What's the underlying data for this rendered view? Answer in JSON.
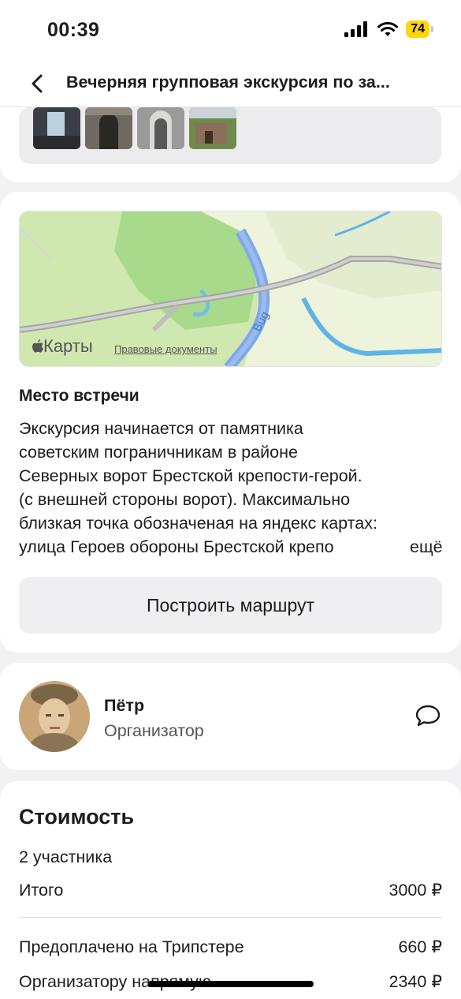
{
  "status": {
    "time": "00:39",
    "battery": "74"
  },
  "nav": {
    "title": "Вечерняя групповая экскурсия по за..."
  },
  "map": {
    "brand": "Карты",
    "legal": "Правовые документы",
    "river_label": "Bug"
  },
  "meeting": {
    "title": "Место встречи",
    "lines": [
      "Экскурсия начинается от памятника",
      "советским пограничникам в районе",
      "Северных ворот Брестской крепости-герой.",
      "(с внешней стороны ворот). Максимально",
      "близкая точка обозначеная на яндекс картах:",
      "улица Героев обороны Брестской крепо"
    ],
    "more": "ещё",
    "route_button": "Построить маршрут"
  },
  "organizer": {
    "name": "Пётр",
    "role": "Организатор"
  },
  "cost": {
    "title": "Стоимость",
    "participants": "2 участника",
    "total_label": "Итого",
    "total_value": "3000 ₽",
    "prepaid_label": "Предоплачено на Трипстере",
    "prepaid_value": "660 ₽",
    "direct_label": "Организатору напрямую",
    "direct_value": "2340 ₽"
  },
  "colors": {
    "accent": "#ffd60a",
    "map_water": "#7fb7e6",
    "map_park": "#bfe3a0"
  }
}
